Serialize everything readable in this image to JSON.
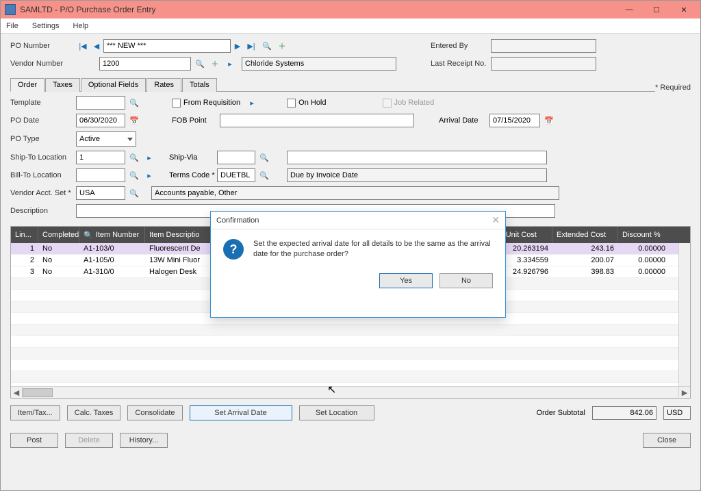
{
  "title": "SAMLTD - P/O Purchase Order Entry",
  "menu": {
    "file": "File",
    "settings": "Settings",
    "help": "Help"
  },
  "header": {
    "po_number_label": "PO Number",
    "po_number_value": "*** NEW ***",
    "vendor_number_label": "Vendor Number",
    "vendor_number_value": "1200",
    "vendor_name": "Chloride Systems",
    "entered_by_label": "Entered By",
    "entered_by_value": "",
    "last_receipt_label": "Last Receipt No.",
    "last_receipt_value": ""
  },
  "tabs": {
    "order": "Order",
    "taxes": "Taxes",
    "optional": "Optional Fields",
    "rates": "Rates",
    "totals": "Totals"
  },
  "required": "*  Required",
  "form": {
    "template_label": "Template",
    "template_value": "",
    "from_req_label": "From Requisition",
    "on_hold_label": "On Hold",
    "job_related_label": "Job Related",
    "po_date_label": "PO Date",
    "po_date_value": "06/30/2020",
    "fob_label": "FOB Point",
    "fob_value": "",
    "arrival_label": "Arrival Date",
    "arrival_value": "07/15/2020",
    "po_type_label": "PO Type",
    "po_type_value": "Active",
    "shipto_label": "Ship-To Location",
    "shipto_value": "1",
    "shipvia_label": "Ship-Via",
    "shipvia_value": "",
    "shipvia_desc": "",
    "billto_label": "Bill-To Location",
    "billto_value": "",
    "terms_label": "Terms Code *",
    "terms_value": "DUETBL",
    "terms_desc": "Due by Invoice Date",
    "vendacct_label": "Vendor Acct. Set *",
    "vendacct_value": "USA",
    "vendacct_desc": "Accounts payable, Other",
    "desc_label": "Description"
  },
  "grid": {
    "headers": {
      "line": "Lin...",
      "completed": "Completed",
      "item_number": "Item Number",
      "item_desc": "Item Descriptio",
      "unit_cost": "Unit Cost",
      "ext_cost": "Extended Cost",
      "disc_pct": "Discount %"
    },
    "rows": [
      {
        "line": "1",
        "completed": "No",
        "item": "A1-103/0",
        "desc": "Fluorescent De",
        "ucost": "20.263194",
        "ext": "243.16",
        "disc": "0.00000"
      },
      {
        "line": "2",
        "completed": "No",
        "item": "A1-105/0",
        "desc": "13W Mini Fluor",
        "ucost": "3.334559",
        "ext": "200.07",
        "disc": "0.00000"
      },
      {
        "line": "3",
        "completed": "No",
        "item": "A1-310/0",
        "desc": "Halogen Desk",
        "ucost": "24.926796",
        "ext": "398.83",
        "disc": "0.00000"
      }
    ]
  },
  "buttons": {
    "item_tax": "Item/Tax...",
    "calc_taxes": "Calc. Taxes",
    "consolidate": "Consolidate",
    "set_arrival": "Set Arrival Date",
    "set_location": "Set Location",
    "post": "Post",
    "delete": "Delete",
    "history": "History...",
    "close": "Close"
  },
  "subtotal": {
    "label": "Order Subtotal",
    "value": "842.06",
    "currency": "USD"
  },
  "modal": {
    "title": "Confirmation",
    "text": "Set the expected arrival date for all details to be the same as the arrival date for the purchase order?",
    "yes": "Yes",
    "no": "No"
  }
}
